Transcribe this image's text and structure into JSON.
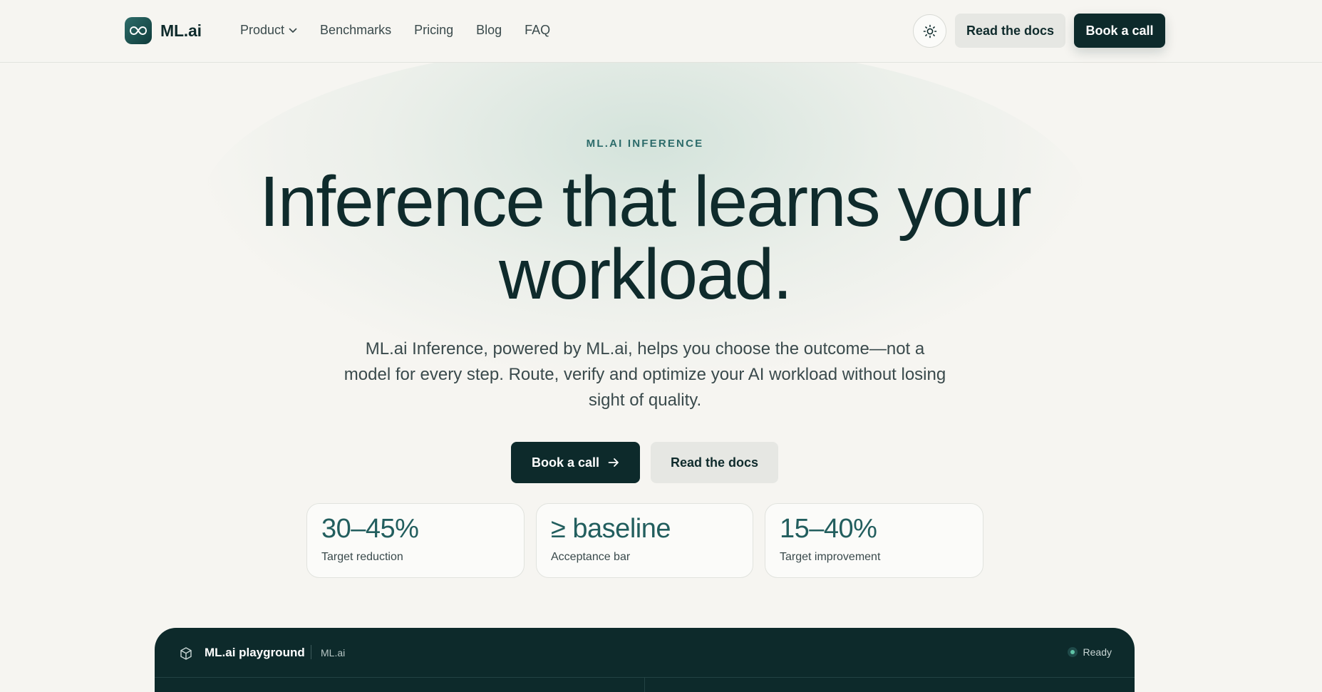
{
  "header": {
    "logo_text": "ML.ai",
    "logo_icon": "infinity-icon",
    "nav": [
      {
        "label": "Product",
        "has_dropdown": true
      },
      {
        "label": "Benchmarks"
      },
      {
        "label": "Pricing"
      },
      {
        "label": "Blog"
      },
      {
        "label": "FAQ"
      }
    ],
    "theme_toggle_icon": "sun-icon",
    "docs_label": "Read the docs",
    "call_label": "Book a call"
  },
  "hero": {
    "eyebrow": "ML.AI INFERENCE",
    "headline": "Inference that learns your workload.",
    "subtext": "ML.ai Inference, powered by ML.ai, helps you choose the outcome—not a model for every step. Route, verify and optimize your AI workload without losing sight of quality.",
    "primary_cta": "Book a call",
    "primary_cta_icon": "arrow-right-icon",
    "secondary_cta": "Read the docs"
  },
  "stats": [
    {
      "value": "30–45%",
      "label": "Target reduction"
    },
    {
      "value": "≥ baseline",
      "label": "Acceptance bar"
    },
    {
      "value": "15–40%",
      "label": "Target improvement"
    }
  ],
  "playground": {
    "icon": "cube-icon",
    "title": "ML.ai playground",
    "subtitle": "ML.ai",
    "status": "Ready"
  },
  "colors": {
    "background": "#f6f5f1",
    "primary_dark": "#0d2a2b",
    "accent_teal": "#225e5e",
    "secondary_button": "#e6e7e3",
    "status_green": "#5fc3a6"
  }
}
